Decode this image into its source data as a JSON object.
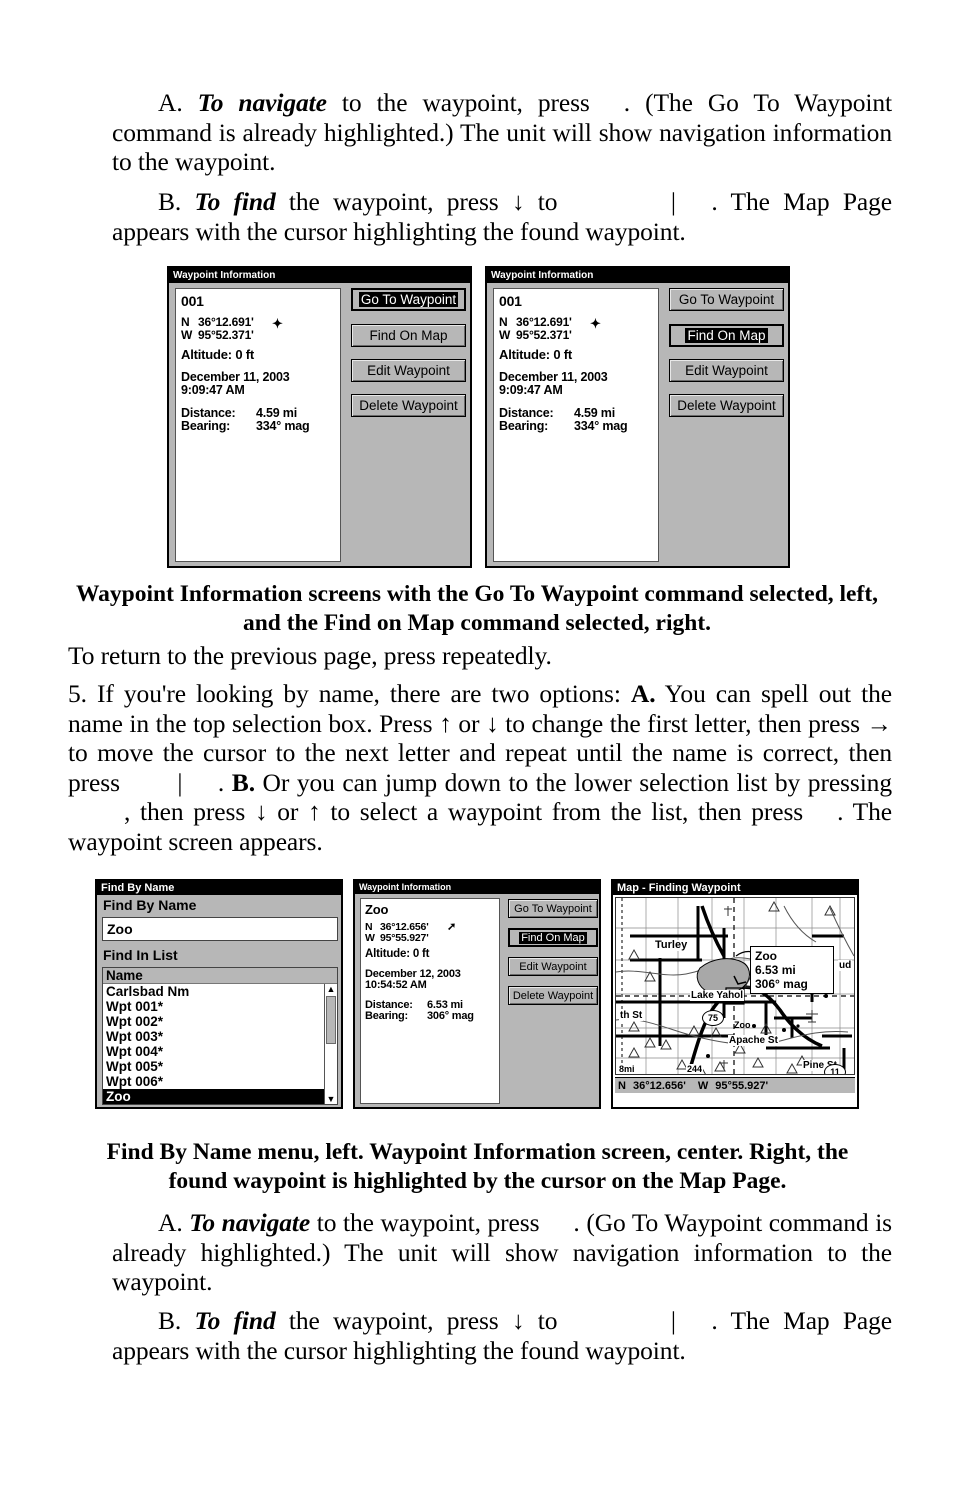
{
  "body_text": {
    "p1": {
      "lead": "A.",
      "bold_italic": "To navigate",
      "t1": "to the waypoint, press",
      "t2": ". (The Go To Waypoint command is already highlighted.) The unit will show navigation information to the waypoint."
    },
    "p2": {
      "lead": "B.",
      "bold_italic": "To find",
      "t1": "the waypoint, press ↓ to",
      "pipe": "|",
      "t2": ". The Map Page appears with the cursor highlighting the found waypoint."
    },
    "caption1": "Waypoint Information screens with the Go To Waypoint command selected, left, and the Find on Map command selected, right.",
    "p3": "To return to the previous page, press         repeatedly.",
    "p4": {
      "s1": "5. If you're looking by name, there are two options:",
      "bold_a": "A.",
      "s2": "You can spell out the name in the top selection box. Press ↑ or ↓ to change the first letter, then press → to move the cursor to the next letter and repeat until the name is correct, then press",
      "pipe": "|",
      "s3": ".",
      "bold_b": "B.",
      "s4": "Or you can jump down to the lower selection list by pressing",
      "s5": ", then press ↓ or ↑ to select a waypoint from the list, then press",
      "s6": ". The waypoint screen appears."
    },
    "caption2": "Find By Name menu, left. Waypoint Information screen, center. Right, the found waypoint is highlighted by the cursor on the Map Page.",
    "p5": {
      "lead": "A.",
      "bold_italic": "To navigate",
      "t1": "to the waypoint, press",
      "t2": ". (Go To Waypoint command is already highlighted.) The unit will show navigation information to the waypoint."
    },
    "p6": {
      "lead": "B.",
      "bold_italic": "To find",
      "t1": "the waypoint, press ↓ to",
      "pipe": "|",
      "t2": ". The Map Page appears with the cursor highlighting the found waypoint."
    }
  },
  "screens": {
    "wp_left": {
      "title": "Waypoint Information",
      "name": "001",
      "lat_hemi": "N",
      "lat": "36°12.691'",
      "lon_hemi": "W",
      "lon": "95°52.371'",
      "altitude": "Altitude: 0 ft",
      "date": "December 11, 2003",
      "time": "9:09:47 AM",
      "distance_label": "Distance:",
      "distance_value": "4.59 mi",
      "bearing_label": "Bearing:",
      "bearing_value": "334° mag",
      "buttons": [
        {
          "label": "Go To Waypoint",
          "selected": true
        },
        {
          "label": "Find On Map",
          "selected": false
        },
        {
          "label": "Edit Waypoint",
          "selected": false
        },
        {
          "label": "Delete Waypoint",
          "selected": false
        }
      ]
    },
    "wp_right": {
      "title": "Waypoint Information",
      "name": "001",
      "lat_hemi": "N",
      "lat": "36°12.691'",
      "lon_hemi": "W",
      "lon": "95°52.371'",
      "altitude": "Altitude: 0 ft",
      "date": "December 11, 2003",
      "time": "9:09:47 AM",
      "distance_label": "Distance:",
      "distance_value": "4.59 mi",
      "bearing_label": "Bearing:",
      "bearing_value": "334° mag",
      "buttons": [
        {
          "label": "Go To Waypoint",
          "selected": false
        },
        {
          "label": "Find On Map",
          "selected": true
        },
        {
          "label": "Edit Waypoint",
          "selected": false
        },
        {
          "label": "Delete Waypoint",
          "selected": false
        }
      ]
    },
    "find_by_name": {
      "title": "Find By Name",
      "section1_label": "Find By Name",
      "input_value": "Zoo",
      "section2_label": "Find In List",
      "list_header": "Name",
      "list_items": [
        {
          "label": "Carlsbad Nm",
          "selected": false
        },
        {
          "label": "Wpt 001*",
          "selected": false
        },
        {
          "label": "Wpt 002*",
          "selected": false
        },
        {
          "label": "Wpt 003*",
          "selected": false
        },
        {
          "label": "Wpt 004*",
          "selected": false
        },
        {
          "label": "Wpt 005*",
          "selected": false
        },
        {
          "label": "Wpt 006*",
          "selected": false
        },
        {
          "label": "Zoo",
          "selected": true
        }
      ],
      "scroll_up": "▲",
      "scroll_down": "▼"
    },
    "wp_center": {
      "title": "Waypoint Information",
      "name": "Zoo",
      "lat_hemi": "N",
      "lat": "36°12.656'",
      "lon_hemi": "W",
      "lon": "95°55.927'",
      "altitude": "Altitude: 0 ft",
      "date": "December 12, 2003",
      "time": "10:54:52 AM",
      "distance_label": "Distance:",
      "distance_value": "6.53 mi",
      "bearing_label": "Bearing:",
      "bearing_value": "306° mag",
      "buttons": [
        {
          "label": "Go To Waypoint",
          "selected": false
        },
        {
          "label": "Find On Map",
          "selected": true
        },
        {
          "label": "Edit Waypoint",
          "selected": false
        },
        {
          "label": "Delete Waypoint",
          "selected": false
        }
      ]
    },
    "map": {
      "title": "Map - Finding Waypoint",
      "popup": {
        "name": "Zoo",
        "distance": "6.53 mi",
        "bearing": "306° mag"
      },
      "labels": {
        "turley": "Turley",
        "lake": "Lake Yahol",
        "th_st": "th St",
        "apache": "Apache St",
        "pine": "Pine St",
        "zoo_marker": "Zoo",
        "ud": "ud",
        "scale": "8mi",
        "hwy_75": "75",
        "hwy_11": "11",
        "hwy_244": "244"
      },
      "status_lat_hemi": "N",
      "status_lat": "36°12.656'",
      "status_lon_hemi": "W",
      "status_lon": "95°55.927'"
    }
  },
  "colors": {
    "screen_bg": "#b7b7b7",
    "pane_bg": "#ffffff",
    "title_bg": "#000000",
    "title_fg": "#ffffff",
    "selected_bg": "#000000",
    "selected_fg": "#ffffff"
  }
}
